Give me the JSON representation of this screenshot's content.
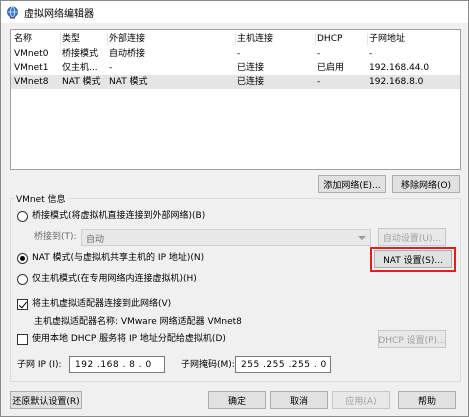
{
  "window": {
    "title": "虚拟网络编辑器"
  },
  "network_table": {
    "headers": [
      "名称",
      "类型",
      "外部连接",
      "主机连接",
      "DHCP",
      "子网地址"
    ],
    "rows": [
      [
        "VMnet0",
        "桥接模式",
        "自动桥接",
        "-",
        "-",
        "-"
      ],
      [
        "VMnet1",
        "仅主机...",
        "-",
        "已连接",
        "已启用",
        "192.168.44.0"
      ],
      [
        "VMnet8",
        "NAT 模式",
        "NAT 模式",
        "已连接",
        "-",
        "192.168.8.0"
      ]
    ],
    "selected_row": "VMnet8"
  },
  "list_buttons": {
    "add": "添加网络(E)...",
    "remove": "移除网络(O)"
  },
  "vmnet_info": {
    "group_label": "VMnet 信息",
    "bridged_label": "桥接模式(将虚拟机直接连接到外部网络)(B)",
    "bridge_to_label": "桥接到(T):",
    "bridge_to_value": "自动",
    "auto_settings_button": "自动设置(U)...",
    "nat_label": "NAT 模式(与虚拟机共享主机的 IP 地址)(N)",
    "nat_settings_button": "NAT 设置(S)...",
    "hostonly_label": "仅主机模式(在专用网络内连接虚拟机)(H)",
    "connect_adapter_label": "将主机虚拟适配器连接到此网络(V)",
    "adapter_name_label": "主机虚拟适配器名称: VMware 网络适配器 VMnet8",
    "dhcp_label": "使用本地 DHCP 服务将 IP 地址分配给虚拟机(D)",
    "dhcp_settings_button": "DHCP 设置(P)...",
    "subnet_ip_label": "子网 IP (I):",
    "subnet_ip_value": "192 .168 . 8 . 0",
    "subnet_mask_label": "子网掩码(M):",
    "subnet_mask_value": "255 .255 .255 . 0",
    "mode": "nat",
    "connect_adapter_checked": true,
    "dhcp_checked": false
  },
  "bottom_buttons": {
    "restore": "还原默认设置(R)",
    "ok": "确定",
    "cancel": "取消",
    "apply": "应用(A)",
    "help": "帮助"
  },
  "colors": {
    "window_bg": "#f0f0f0",
    "highlight_border": "#e02020",
    "selected_row_bg": "#e5e5e5"
  }
}
